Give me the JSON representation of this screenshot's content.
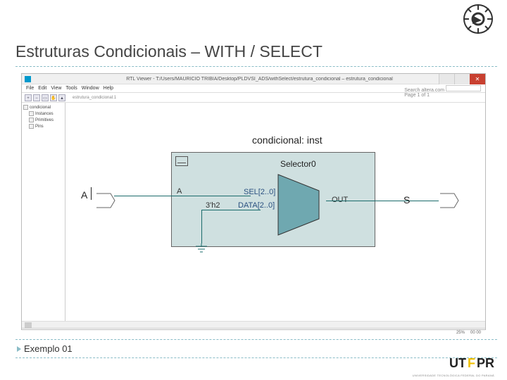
{
  "slide": {
    "title": "Estruturas Condicionais – WITH / SELECT",
    "example_label": "Exemplo 01"
  },
  "viewer": {
    "window_title": "RTL Viewer - T:/Users/MAURICIO TRIBIA/Desktop/PLDVSI_ADS/withSelect/estrutura_condicional – estrutura_condicional",
    "menu": {
      "file": "File",
      "edit": "Edit",
      "view": "View",
      "tools": "Tools",
      "window": "Window",
      "help": "Help"
    },
    "search": {
      "label": "Search altera.com",
      "page_info": "Page",
      "page_of": "1 of 1"
    },
    "side": {
      "instance": "estrutura_condicional:1",
      "in_group": "Instances",
      "cond": "condicional",
      "prims": "Primitives",
      "pins": "Pins"
    },
    "status": {
      "zoom": "25%",
      "coords": "00   00"
    }
  },
  "schematic": {
    "instance_label": "condicional: inst",
    "selector_label": "Selector0",
    "port_a": "A",
    "a_inner": "A",
    "sel_label": "SEL[2..0]",
    "data_label": "DATA[2..0]",
    "const_label": "3'h2",
    "out_label": "OUT",
    "port_s": "S"
  },
  "branding": {
    "utfpr": "UT",
    "utfpr_f": "F",
    "utfpr_pr": "PR",
    "utfpr_sub": "UNIVERSIDADE TECNOLÓGICA FEDERAL DO PARANÁ"
  }
}
